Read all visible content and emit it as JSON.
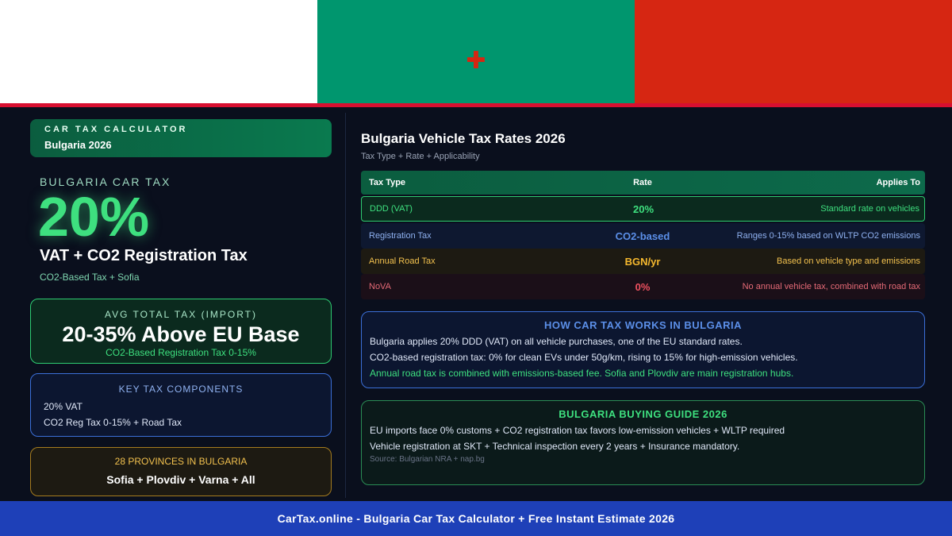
{
  "flag": {
    "colors": [
      "#ffffff",
      "#00966e",
      "#d62612"
    ],
    "bottom_colors": [
      "#d80f30",
      "#d80f30",
      "#d80f30"
    ],
    "cross_icon": "cross-icon",
    "cross_color": "#d62612"
  },
  "brand": {
    "eyebrow": "CAR TAX CALCULATOR",
    "subtitle": "Bulgaria 2026"
  },
  "headline": {
    "label": "BULGARIA CAR TAX",
    "value": "20%",
    "title": "VAT + CO2 Registration Tax",
    "subtitle": "CO2-Based Tax + Sofia"
  },
  "avg_box": {
    "label": "AVG TOTAL TAX (IMPORT)",
    "value": "20-35% Above EU Base",
    "note": "CO2-Based Registration Tax 0-15%"
  },
  "components": {
    "title": "KEY TAX COMPONENTS",
    "lines": [
      "20% VAT",
      "CO2 Reg Tax 0-15% + Road Tax"
    ]
  },
  "provinces": {
    "title": "28 PROVINCES IN BULGARIA",
    "value": "Sofia + Plovdiv + Varna + All"
  },
  "table": {
    "title": "Bulgaria Vehicle Tax Rates 2026",
    "subtitle": "Tax Type + Rate + Applicability",
    "headers": [
      "Tax Type",
      "Rate",
      "Applies To"
    ],
    "rows": [
      {
        "type": "DDD (VAT)",
        "rate": "20%",
        "applies": "Standard rate on vehicles"
      },
      {
        "type": "Registration Tax",
        "rate": "CO2-based",
        "applies": "Ranges 0-15% based on WLTP CO2 emissions"
      },
      {
        "type": "Annual Road Tax",
        "rate": "BGN/yr",
        "applies": "Based on vehicle type and emissions"
      },
      {
        "type": "NoVA",
        "rate": "0%",
        "applies": "No annual vehicle tax, combined with road tax"
      }
    ]
  },
  "how": {
    "title": "HOW CAR TAX WORKS IN BULGARIA",
    "lines": [
      "Bulgaria applies 20% DDD (VAT) on all vehicle purchases, one of the EU standard rates.",
      "CO2-based registration tax: 0% for clean EVs under 50g/km, rising to 15% for high-emission vehicles.",
      "Annual road tax is combined with emissions-based fee. Sofia and Plovdiv are main registration hubs."
    ]
  },
  "guide": {
    "title": "BULGARIA BUYING GUIDE 2026",
    "lines": [
      "EU imports face 0% customs + CO2 registration tax favors low-emission vehicles + WLTP required",
      "Vehicle registration at SKT + Technical inspection every 2 years + Insurance mandatory."
    ],
    "source": "Source: Bulgarian NRA + nap.bg"
  },
  "footer": {
    "text": "CarTax.online - Bulgaria Car Tax Calculator + Free Instant Estimate 2026"
  }
}
